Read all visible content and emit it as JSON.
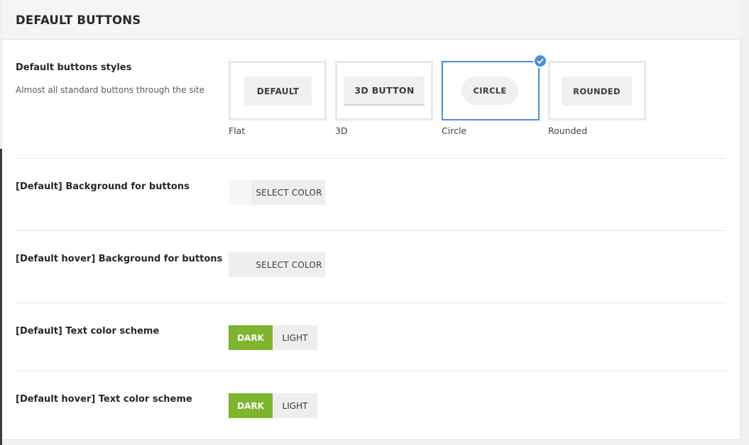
{
  "section": {
    "title": "DEFAULT BUTTONS"
  },
  "styles_row": {
    "label": "Default buttons styles",
    "description": "Almost all standard buttons through the site",
    "options": [
      {
        "sample": "DEFAULT",
        "caption": "Flat",
        "selected": false
      },
      {
        "sample": "3D BUTTON",
        "caption": "3D",
        "selected": false
      },
      {
        "sample": "CIRCLE",
        "caption": "Circle",
        "selected": true
      },
      {
        "sample": "ROUNDED",
        "caption": "Rounded",
        "selected": false
      }
    ]
  },
  "bg_row": {
    "label": "[Default] Background for buttons",
    "button": "SELECT COLOR"
  },
  "bg_hover_row": {
    "label": "[Default hover] Background for buttons",
    "button": "SELECT COLOR"
  },
  "text_row": {
    "label": "[Default] Text color scheme",
    "dark": "DARK",
    "light": "LIGHT",
    "selected": "DARK"
  },
  "text_hover_row": {
    "label": "[Default hover] Text color scheme",
    "dark": "DARK",
    "light": "LIGHT",
    "selected": "DARK"
  },
  "colors": {
    "accent_green": "#7db52f",
    "selected_blue": "#4a90d9"
  },
  "icons": {
    "selected_badge": "checkmark-icon"
  }
}
